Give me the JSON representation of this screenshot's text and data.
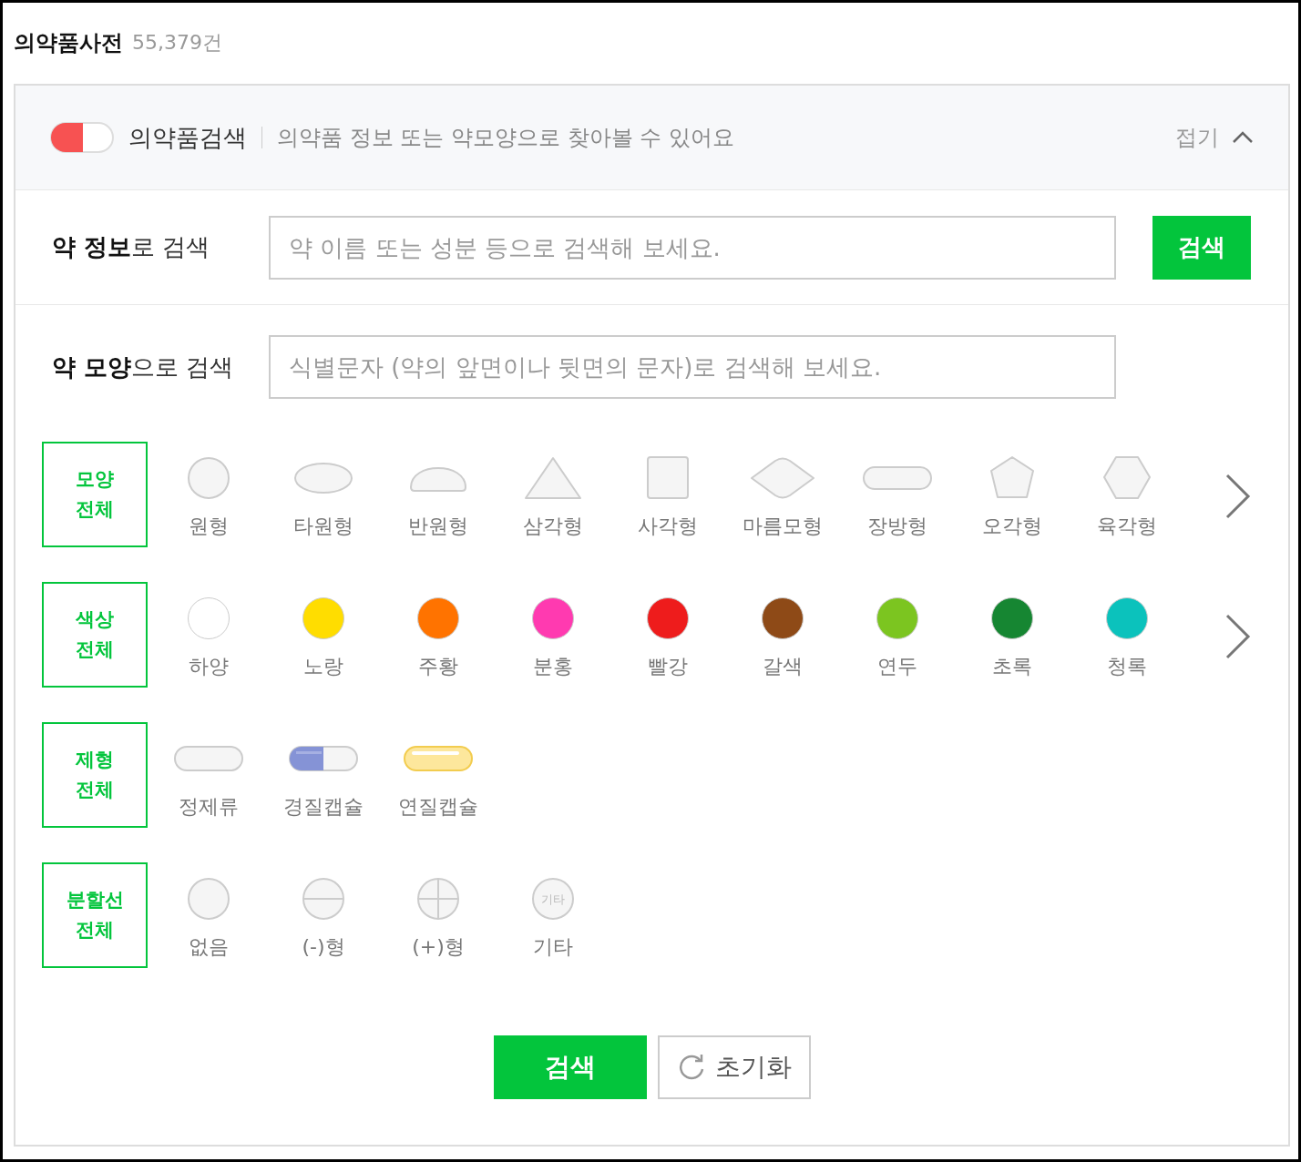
{
  "header": {
    "title": "의약품사전",
    "count": "55,379건"
  },
  "panel": {
    "title": "의약품검색",
    "description": "의약품 정보 또는 약모양으로 찾아볼 수 있어요",
    "collapse": "접기",
    "expanded": true
  },
  "info_search": {
    "label": "**약 정보**로 검색",
    "placeholder": "약 이름 또는 성분 등으로 검색해 보세요.",
    "button": "검색"
  },
  "shape_search": {
    "label": "**약 모양**으로 검색",
    "placeholder": "식별문자 (약의 앞면이나 뒷면의 문자)로 검색해 보세요."
  },
  "filters": [
    {
      "kind": "shape",
      "all": {
        "label": "모양\n전체",
        "selected": true
      },
      "has_next": true,
      "items": [
        {
          "kind": "circle",
          "label": "원형",
          "selected": false
        },
        {
          "kind": "oval",
          "label": "타원형",
          "selected": false
        },
        {
          "kind": "semicircle",
          "label": "반원형",
          "selected": false
        },
        {
          "kind": "triangle",
          "label": "삼각형",
          "selected": false
        },
        {
          "kind": "square",
          "label": "사각형",
          "selected": false
        },
        {
          "kind": "diamond",
          "label": "마름모형",
          "selected": false
        },
        {
          "kind": "oblong",
          "label": "장방형",
          "selected": false
        },
        {
          "kind": "pentagon",
          "label": "오각형",
          "selected": false
        },
        {
          "kind": "hexagon",
          "label": "육각형",
          "selected": false
        }
      ]
    },
    {
      "kind": "color",
      "all": {
        "label": "색상\n전체",
        "selected": true
      },
      "has_next": true,
      "items": [
        {
          "label": "하양",
          "color": "#ffffff",
          "selected": false
        },
        {
          "label": "노랑",
          "color": "#ffdd00",
          "selected": false
        },
        {
          "label": "주황",
          "color": "#ff7300",
          "selected": false
        },
        {
          "label": "분홍",
          "color": "#ff3ab0",
          "selected": false
        },
        {
          "label": "빨강",
          "color": "#ee1c1c",
          "selected": false
        },
        {
          "label": "갈색",
          "color": "#8e4a17",
          "selected": false
        },
        {
          "label": "연두",
          "color": "#7cc520",
          "selected": false
        },
        {
          "label": "초록",
          "color": "#168632",
          "selected": false
        },
        {
          "label": "청록",
          "color": "#0bc2bc",
          "selected": false
        }
      ]
    },
    {
      "kind": "form",
      "all": {
        "label": "제형\n전체",
        "selected": true
      },
      "has_next": false,
      "items": [
        {
          "kind": "tablet",
          "label": "정제류",
          "selected": false
        },
        {
          "kind": "hard-capsule",
          "label": "경질캡슐",
          "selected": false
        },
        {
          "kind": "soft-capsule",
          "label": "연질캡슐",
          "selected": false
        }
      ]
    },
    {
      "kind": "split",
      "all": {
        "label": "분할선\n전체",
        "selected": true
      },
      "has_next": false,
      "items": [
        {
          "kind": "none",
          "label": "없음",
          "selected": false
        },
        {
          "kind": "minus",
          "label": "(-)형",
          "selected": false
        },
        {
          "kind": "plus",
          "label": "(+)형",
          "selected": false
        },
        {
          "kind": "other",
          "label": "기타",
          "icon_text": "기타",
          "selected": false
        }
      ]
    }
  ],
  "actions": {
    "search": "검색",
    "reset": "초기화"
  }
}
